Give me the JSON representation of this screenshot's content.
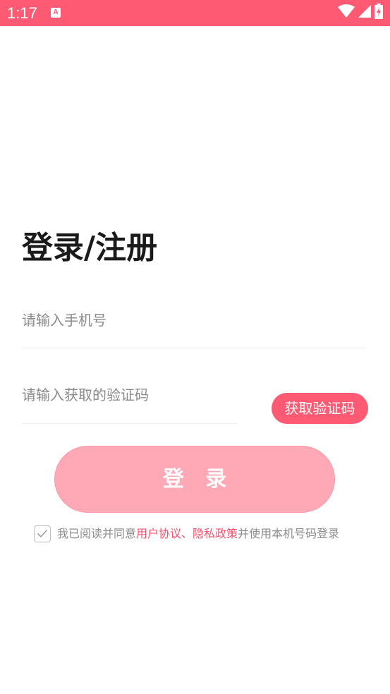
{
  "status_bar": {
    "time": "1:17",
    "app_icon_letter": "A",
    "background_color": "#ff5a73"
  },
  "login": {
    "title": "登录/注册",
    "phone_placeholder": "请输入手机号",
    "code_placeholder": "请输入获取的验证码",
    "get_code_label": "获取验证码",
    "login_label": "登 录"
  },
  "agreement": {
    "checked": true,
    "text_prefix": "我已阅读并同意",
    "user_agreement_link": "用户协议",
    "separator": "、",
    "privacy_policy_link": "隐私政策",
    "text_suffix": "并使用本机号码登录"
  },
  "colors": {
    "accent": "#ff5a73",
    "login_button": "#ffa8b6",
    "link": "#ff4f6d"
  },
  "icons": [
    "app-notification-icon",
    "wifi-icon",
    "cellular-signal-icon",
    "battery-charging-icon",
    "checkmark-icon"
  ]
}
